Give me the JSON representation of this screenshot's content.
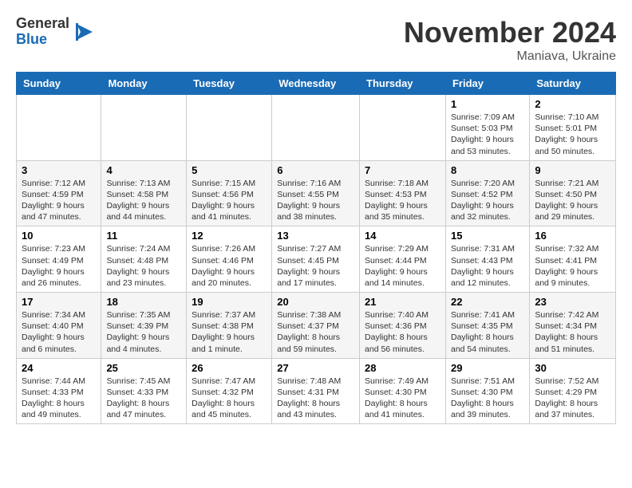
{
  "logo": {
    "general": "General",
    "blue": "Blue"
  },
  "title": "November 2024",
  "location": "Maniava, Ukraine",
  "days_header": [
    "Sunday",
    "Monday",
    "Tuesday",
    "Wednesday",
    "Thursday",
    "Friday",
    "Saturday"
  ],
  "weeks": [
    [
      {
        "day": "",
        "info": ""
      },
      {
        "day": "",
        "info": ""
      },
      {
        "day": "",
        "info": ""
      },
      {
        "day": "",
        "info": ""
      },
      {
        "day": "",
        "info": ""
      },
      {
        "day": "1",
        "info": "Sunrise: 7:09 AM\nSunset: 5:03 PM\nDaylight: 9 hours\nand 53 minutes."
      },
      {
        "day": "2",
        "info": "Sunrise: 7:10 AM\nSunset: 5:01 PM\nDaylight: 9 hours\nand 50 minutes."
      }
    ],
    [
      {
        "day": "3",
        "info": "Sunrise: 7:12 AM\nSunset: 4:59 PM\nDaylight: 9 hours\nand 47 minutes."
      },
      {
        "day": "4",
        "info": "Sunrise: 7:13 AM\nSunset: 4:58 PM\nDaylight: 9 hours\nand 44 minutes."
      },
      {
        "day": "5",
        "info": "Sunrise: 7:15 AM\nSunset: 4:56 PM\nDaylight: 9 hours\nand 41 minutes."
      },
      {
        "day": "6",
        "info": "Sunrise: 7:16 AM\nSunset: 4:55 PM\nDaylight: 9 hours\nand 38 minutes."
      },
      {
        "day": "7",
        "info": "Sunrise: 7:18 AM\nSunset: 4:53 PM\nDaylight: 9 hours\nand 35 minutes."
      },
      {
        "day": "8",
        "info": "Sunrise: 7:20 AM\nSunset: 4:52 PM\nDaylight: 9 hours\nand 32 minutes."
      },
      {
        "day": "9",
        "info": "Sunrise: 7:21 AM\nSunset: 4:50 PM\nDaylight: 9 hours\nand 29 minutes."
      }
    ],
    [
      {
        "day": "10",
        "info": "Sunrise: 7:23 AM\nSunset: 4:49 PM\nDaylight: 9 hours\nand 26 minutes."
      },
      {
        "day": "11",
        "info": "Sunrise: 7:24 AM\nSunset: 4:48 PM\nDaylight: 9 hours\nand 23 minutes."
      },
      {
        "day": "12",
        "info": "Sunrise: 7:26 AM\nSunset: 4:46 PM\nDaylight: 9 hours\nand 20 minutes."
      },
      {
        "day": "13",
        "info": "Sunrise: 7:27 AM\nSunset: 4:45 PM\nDaylight: 9 hours\nand 17 minutes."
      },
      {
        "day": "14",
        "info": "Sunrise: 7:29 AM\nSunset: 4:44 PM\nDaylight: 9 hours\nand 14 minutes."
      },
      {
        "day": "15",
        "info": "Sunrise: 7:31 AM\nSunset: 4:43 PM\nDaylight: 9 hours\nand 12 minutes."
      },
      {
        "day": "16",
        "info": "Sunrise: 7:32 AM\nSunset: 4:41 PM\nDaylight: 9 hours\nand 9 minutes."
      }
    ],
    [
      {
        "day": "17",
        "info": "Sunrise: 7:34 AM\nSunset: 4:40 PM\nDaylight: 9 hours\nand 6 minutes."
      },
      {
        "day": "18",
        "info": "Sunrise: 7:35 AM\nSunset: 4:39 PM\nDaylight: 9 hours\nand 4 minutes."
      },
      {
        "day": "19",
        "info": "Sunrise: 7:37 AM\nSunset: 4:38 PM\nDaylight: 9 hours\nand 1 minute."
      },
      {
        "day": "20",
        "info": "Sunrise: 7:38 AM\nSunset: 4:37 PM\nDaylight: 8 hours\nand 59 minutes."
      },
      {
        "day": "21",
        "info": "Sunrise: 7:40 AM\nSunset: 4:36 PM\nDaylight: 8 hours\nand 56 minutes."
      },
      {
        "day": "22",
        "info": "Sunrise: 7:41 AM\nSunset: 4:35 PM\nDaylight: 8 hours\nand 54 minutes."
      },
      {
        "day": "23",
        "info": "Sunrise: 7:42 AM\nSunset: 4:34 PM\nDaylight: 8 hours\nand 51 minutes."
      }
    ],
    [
      {
        "day": "24",
        "info": "Sunrise: 7:44 AM\nSunset: 4:33 PM\nDaylight: 8 hours\nand 49 minutes."
      },
      {
        "day": "25",
        "info": "Sunrise: 7:45 AM\nSunset: 4:33 PM\nDaylight: 8 hours\nand 47 minutes."
      },
      {
        "day": "26",
        "info": "Sunrise: 7:47 AM\nSunset: 4:32 PM\nDaylight: 8 hours\nand 45 minutes."
      },
      {
        "day": "27",
        "info": "Sunrise: 7:48 AM\nSunset: 4:31 PM\nDaylight: 8 hours\nand 43 minutes."
      },
      {
        "day": "28",
        "info": "Sunrise: 7:49 AM\nSunset: 4:30 PM\nDaylight: 8 hours\nand 41 minutes."
      },
      {
        "day": "29",
        "info": "Sunrise: 7:51 AM\nSunset: 4:30 PM\nDaylight: 8 hours\nand 39 minutes."
      },
      {
        "day": "30",
        "info": "Sunrise: 7:52 AM\nSunset: 4:29 PM\nDaylight: 8 hours\nand 37 minutes."
      }
    ]
  ]
}
